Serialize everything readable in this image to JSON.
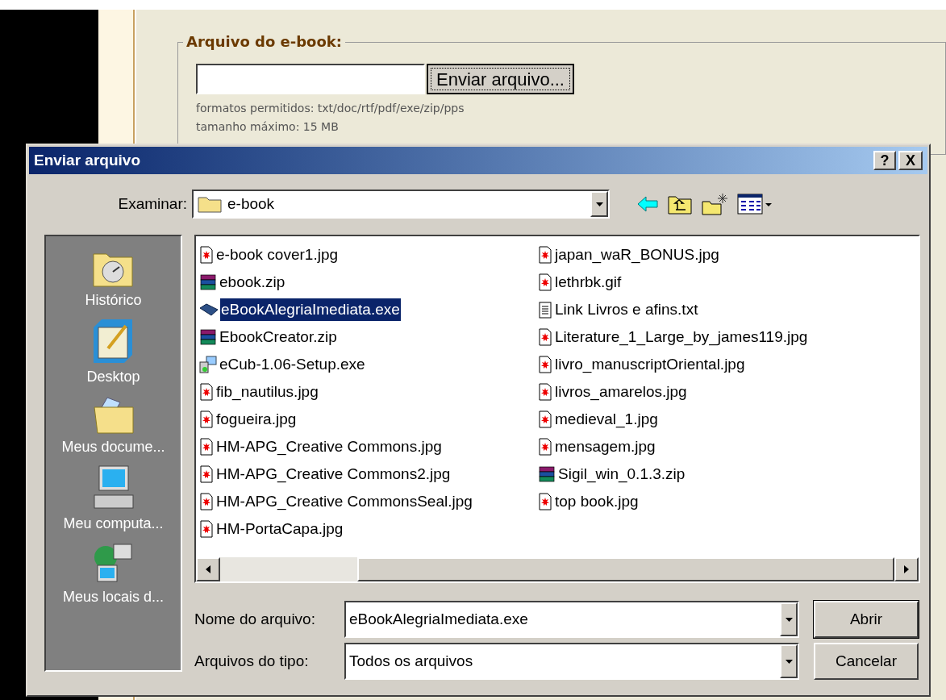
{
  "page": {
    "legend": "Arquivo do e-book:",
    "upload_button": "Enviar arquivo...",
    "hints": [
      "formatos permitidos: txt/doc/rtf/pdf/exe/zip/pps",
      "tamanho máximo: 15 MB"
    ]
  },
  "dialog": {
    "title": "Enviar arquivo",
    "help": "?",
    "close": "X",
    "look_in": {
      "label": "Examinar:",
      "value": "e-book"
    },
    "places": [
      {
        "label": "Histórico",
        "kind": "history"
      },
      {
        "label": "Desktop",
        "kind": "desktop"
      },
      {
        "label": "Meus docume...",
        "kind": "documents"
      },
      {
        "label": "Meu computa...",
        "kind": "computer"
      },
      {
        "label": "Meus locais d...",
        "kind": "network"
      }
    ],
    "files": [
      {
        "name": "e-book cover1.jpg",
        "kind": "image",
        "selected": false
      },
      {
        "name": "ebook.zip",
        "kind": "zip",
        "selected": false
      },
      {
        "name": "eBookAlegriaImediata.exe",
        "kind": "exe",
        "selected": true
      },
      {
        "name": "EbookCreator.zip",
        "kind": "zip",
        "selected": false
      },
      {
        "name": "eCub-1.06-Setup.exe",
        "kind": "setup",
        "selected": false
      },
      {
        "name": "fib_nautilus.jpg",
        "kind": "image",
        "selected": false
      },
      {
        "name": "fogueira.jpg",
        "kind": "image",
        "selected": false
      },
      {
        "name": "HM-APG_Creative Commons.jpg",
        "kind": "image",
        "selected": false
      },
      {
        "name": "HM-APG_Creative Commons2.jpg",
        "kind": "image",
        "selected": false
      },
      {
        "name": "HM-APG_Creative CommonsSeal.jpg",
        "kind": "image",
        "selected": false
      },
      {
        "name": "HM-PortaCapa.jpg",
        "kind": "image",
        "selected": false
      },
      {
        "name": "japan_waR_BONUS.jpg",
        "kind": "image",
        "selected": false
      },
      {
        "name": "lethrbk.gif",
        "kind": "image",
        "selected": false
      },
      {
        "name": "Link Livros e afins.txt",
        "kind": "text",
        "selected": false
      },
      {
        "name": "Literature_1_Large_by_james119.jpg",
        "kind": "image",
        "selected": false
      },
      {
        "name": "livro_manuscriptOriental.jpg",
        "kind": "image",
        "selected": false
      },
      {
        "name": "livros_amarelos.jpg",
        "kind": "image",
        "selected": false
      },
      {
        "name": "medieval_1.jpg",
        "kind": "image",
        "selected": false
      },
      {
        "name": "mensagem.jpg",
        "kind": "image",
        "selected": false
      },
      {
        "name": "Sigil_win_0.1.3.zip",
        "kind": "zip",
        "selected": false
      },
      {
        "name": "top book.jpg",
        "kind": "image",
        "selected": false
      }
    ],
    "file_name": {
      "label": "Nome do arquivo:",
      "value": "eBookAlegriaImediata.exe"
    },
    "file_type": {
      "label": "Arquivos do tipo:",
      "value": "Todos os arquivos"
    },
    "buttons": [
      "Abrir",
      "Cancelar"
    ]
  }
}
